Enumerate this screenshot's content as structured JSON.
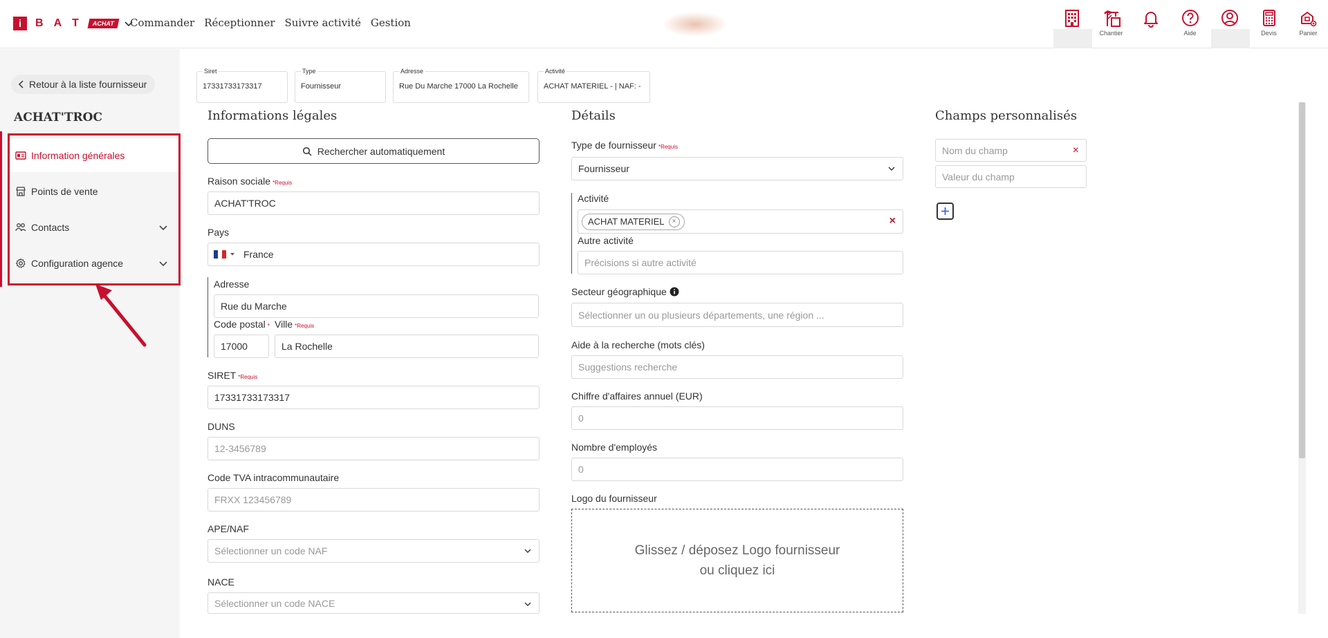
{
  "header": {
    "logo_i": "i",
    "logo_letters": [
      "B",
      "A",
      "T"
    ],
    "logo_badge": "ACHAT",
    "nav": [
      "Commander",
      "Réceptionner",
      "Suivre activité",
      "Gestion"
    ],
    "icons": [
      {
        "name": "building-icon",
        "label": ""
      },
      {
        "name": "crane-icon",
        "label": "Chantier"
      },
      {
        "name": "bell-icon",
        "label": ""
      },
      {
        "name": "help-icon",
        "label": "Aide"
      },
      {
        "name": "user-icon",
        "label": ""
      },
      {
        "name": "calculator-icon",
        "label": "Devis"
      },
      {
        "name": "cart-icon",
        "label": "Panier"
      }
    ],
    "accent": "#c8102e"
  },
  "sidebar": {
    "back_label": "Retour à la liste fournisseur",
    "company": "ACHAT'TROC",
    "items": [
      {
        "label": "Information générales",
        "icon": "id-card-icon",
        "active": true
      },
      {
        "label": "Points de vente",
        "icon": "store-icon"
      },
      {
        "label": "Contacts",
        "icon": "users-icon",
        "expandable": true
      },
      {
        "label": "Configuration agence",
        "icon": "gear-icon",
        "expandable": true
      }
    ]
  },
  "summary": {
    "siret_label": "Siret",
    "siret_value": "17331733173317",
    "type_label": "Type",
    "type_value": "Fournisseur",
    "adresse_label": "Adresse",
    "adresse_value": "Rue Du Marche 17000 La Rochelle",
    "activite_label": "Activité",
    "activite_value": "ACHAT MATERIEL - | NAF: -"
  },
  "legal": {
    "title": "Informations légales",
    "search_button": "Rechercher automatiquement",
    "raison_label": "Raison sociale",
    "required": "*Requis",
    "raison_value": "ACHAT'TROC",
    "pays_label": "Pays",
    "pays_value": "France",
    "adresse_label": "Adresse",
    "adresse_value": "Rue du Marche",
    "cp_label": "Code postal",
    "cp_value": "17000",
    "ville_label": "Ville",
    "ville_value": "La Rochelle",
    "siret_label": "SIRET",
    "siret_value": "17331733173317",
    "duns_label": "DUNS",
    "duns_placeholder": "12-3456789",
    "tva_label": "Code TVA intracommunautaire",
    "tva_placeholder": "FRXX 123456789",
    "ape_label": "APE/NAF",
    "ape_placeholder": "Sélectionner un code NAF",
    "nace_label": "NACE",
    "nace_placeholder": "Sélectionner un code NACE"
  },
  "details": {
    "title": "Détails",
    "type_label": "Type de fournisseur",
    "type_value": "Fournisseur",
    "activite_label": "Activité",
    "activite_tag": "ACHAT MATERIEL",
    "autre_label": "Autre activité",
    "autre_placeholder": "Précisions si autre activité",
    "secteur_label": "Secteur géographique",
    "secteur_placeholder": "Sélectionner un ou plusieurs départements, une région ...",
    "aide_label": "Aide à la recherche (mots clés)",
    "aide_placeholder": "Suggestions recherche",
    "ca_label": "Chiffre d'affaires annuel (EUR)",
    "ca_placeholder": "0",
    "employes_label": "Nombre d'employés",
    "employes_placeholder": "0",
    "logo_label": "Logo du fournisseur",
    "drop_line1": "Glissez / déposez Logo fournisseur",
    "drop_line2": "ou cliquez ici"
  },
  "custom": {
    "title": "Champs personnalisés",
    "name_placeholder": "Nom du champ",
    "value_placeholder": "Valeur du champ"
  }
}
